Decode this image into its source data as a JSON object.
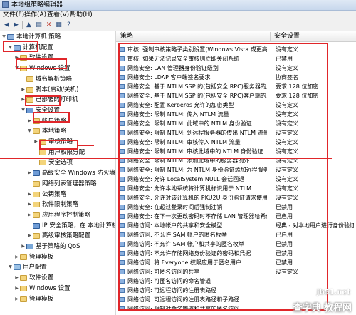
{
  "window": {
    "title": "本地组策略编辑器"
  },
  "menu": [
    "文件(F)",
    "操作(A)",
    "查看(V)",
    "帮助(H)"
  ],
  "toolbar_icons": [
    "back-icon",
    "forward-icon",
    "up-icon",
    "show-tree-icon",
    "delete-icon",
    "properties-icon",
    "help-icon"
  ],
  "tree": [
    {
      "label": "本地计算机 策略",
      "indent": 0,
      "icon": "comp",
      "arrow": "▼"
    },
    {
      "label": "计算机配置",
      "indent": 1,
      "icon": "comp",
      "arrow": "▼"
    },
    {
      "label": "软件设置",
      "indent": 2,
      "icon": "folder",
      "arrow": "▶"
    },
    {
      "label": "Windows 设置",
      "indent": 2,
      "icon": "folder",
      "arrow": "▼"
    },
    {
      "label": "域名解析策略",
      "indent": 3,
      "icon": "folder",
      "arrow": ""
    },
    {
      "label": "脚本(启动/关机)",
      "indent": 3,
      "icon": "folder",
      "arrow": "▶"
    },
    {
      "label": "已部署的打印机",
      "indent": 3,
      "icon": "folder",
      "arrow": "▶"
    },
    {
      "label": "安全设置",
      "indent": 3,
      "icon": "shield",
      "arrow": "▼"
    },
    {
      "label": "帐户策略",
      "indent": 4,
      "icon": "folder",
      "arrow": "▶"
    },
    {
      "label": "本地策略",
      "indent": 4,
      "icon": "folder",
      "arrow": "▼"
    },
    {
      "label": "审核策略",
      "indent": 5,
      "icon": "folder",
      "arrow": "▶"
    },
    {
      "label": "用户权限分配",
      "indent": 5,
      "icon": "folder",
      "arrow": ""
    },
    {
      "label": "安全选项",
      "indent": 5,
      "icon": "folder",
      "arrow": ""
    },
    {
      "label": "高级安全 Windows 防火墙",
      "indent": 4,
      "icon": "shield",
      "arrow": "▶"
    },
    {
      "label": "网络列表管理器策略",
      "indent": 4,
      "icon": "folder",
      "arrow": ""
    },
    {
      "label": "公钥策略",
      "indent": 4,
      "icon": "folder",
      "arrow": "▶"
    },
    {
      "label": "软件限制策略",
      "indent": 4,
      "icon": "folder",
      "arrow": "▶"
    },
    {
      "label": "应用程序控制策略",
      "indent": 4,
      "icon": "folder",
      "arrow": "▶"
    },
    {
      "label": "IP 安全策略，在 本地计算机",
      "indent": 4,
      "icon": "shield",
      "arrow": ""
    },
    {
      "label": "高级审核策略配置",
      "indent": 4,
      "icon": "folder",
      "arrow": "▶"
    },
    {
      "label": "基于策略的 QoS",
      "indent": 3,
      "icon": "chart",
      "arrow": "▶"
    },
    {
      "label": "管理模板",
      "indent": 2,
      "icon": "folder",
      "arrow": "▶"
    },
    {
      "label": "用户配置",
      "indent": 1,
      "icon": "user",
      "arrow": "▼"
    },
    {
      "label": "软件设置",
      "indent": 2,
      "icon": "folder",
      "arrow": "▶"
    },
    {
      "label": "Windows 设置",
      "indent": 2,
      "icon": "folder",
      "arrow": "▶"
    },
    {
      "label": "管理模板",
      "indent": 2,
      "icon": "folder",
      "arrow": "▶"
    }
  ],
  "list_header": {
    "policy": "策略",
    "setting": "安全设置"
  },
  "rows": [
    {
      "policy": "审核: 强制审核策略子类别设置(Windows Vista 或更高版本)替代审核策略类别设置",
      "setting": "没有定义"
    },
    {
      "policy": "审核: 如果无法记录安全审核则立即关闭系统",
      "setting": "已禁用"
    },
    {
      "policy": "网络安全: LAN 管理器身份验证级别",
      "setting": "没有定义"
    },
    {
      "policy": "网络安全: LDAP 客户端签名要求",
      "setting": "协商签名"
    },
    {
      "policy": "网络安全: 基于 NTLM SSP 的(包括安全 RPC)服务器的最小会话安全",
      "setting": "要求 128 位加密"
    },
    {
      "policy": "网络安全: 基于 NTLM SSP 的(包括安全 RPC)客户端的最小会话安全",
      "setting": "要求 128 位加密"
    },
    {
      "policy": "网络安全: 配置 Kerberos 允许的加密类型",
      "setting": "没有定义"
    },
    {
      "policy": "网络安全: 限制 NTLM: 传入 NTLM 流量",
      "setting": "没有定义"
    },
    {
      "policy": "网络安全: 限制 NTLM: 此域中的 NTLM 身份验证",
      "setting": "没有定义"
    },
    {
      "policy": "网络安全: 限制 NTLM: 到远程服务器的传出 NTLM 流量",
      "setting": "没有定义"
    },
    {
      "policy": "网络安全: 限制 NTLM: 审核传入 NTLM 流量",
      "setting": "没有定义"
    },
    {
      "policy": "网络安全: 限制 NTLM: 审核此域中的 NTLM 身份验证",
      "setting": "没有定义"
    },
    {
      "policy": "网络安全: 限制 NTLM: 添加此域中的服务器例外",
      "setting": "没有定义"
    },
    {
      "policy": "网络安全: 限制 NTLM: 为 NTLM 身份验证添加远程服务器例外",
      "setting": "没有定义"
    },
    {
      "policy": "网络安全: 允许 LocalSystem NULL 会话回退",
      "setting": "没有定义"
    },
    {
      "policy": "网络安全: 允许本地系统将计算机标识用于 NTLM",
      "setting": "没有定义"
    },
    {
      "policy": "网络安全: 允许对该计算机的 PKU2U 身份验证请求使用联机标识",
      "setting": "没有定义"
    },
    {
      "policy": "网络安全: 在超过登录时间后强制注销",
      "setting": "已禁用"
    },
    {
      "policy": "网络安全: 在下一次更改密码时不存储 LAN 管理器哈希值",
      "setting": "已启用"
    },
    {
      "policy": "网络访问: 本地帐户的共享和安全模型",
      "setting": "经典 - 对本地用户进行身份验证"
    },
    {
      "policy": "网络访问: 不允许 SAM 帐户的匿名枚举",
      "setting": "已启用"
    },
    {
      "policy": "网络访问: 不允许 SAM 帐户和共享的匿名枚举",
      "setting": "已禁用"
    },
    {
      "policy": "网络访问: 不允许存储网络身份验证的密码和凭据",
      "setting": "已禁用"
    },
    {
      "policy": "网络访问: 将 Everyone 权限应用于匿名用户",
      "setting": "已禁用"
    },
    {
      "policy": "网络访问: 可匿名访问的共享",
      "setting": "没有定义"
    },
    {
      "policy": "网络访问: 可匿名访问的命名管道",
      "setting": ""
    },
    {
      "policy": "网络访问: 可远程访问的注册表路径",
      "setting": ""
    },
    {
      "policy": "网络访问: 可远程访问的注册表路径和子路径",
      "setting": ""
    },
    {
      "policy": "网络访问: 限制对命名管道和共享的匿名访问",
      "setting": ""
    }
  ],
  "watermark": {
    "site": "jb51.net",
    "text": "查字典 教程网",
    "url": "jiaocheng.chazidian.com"
  }
}
